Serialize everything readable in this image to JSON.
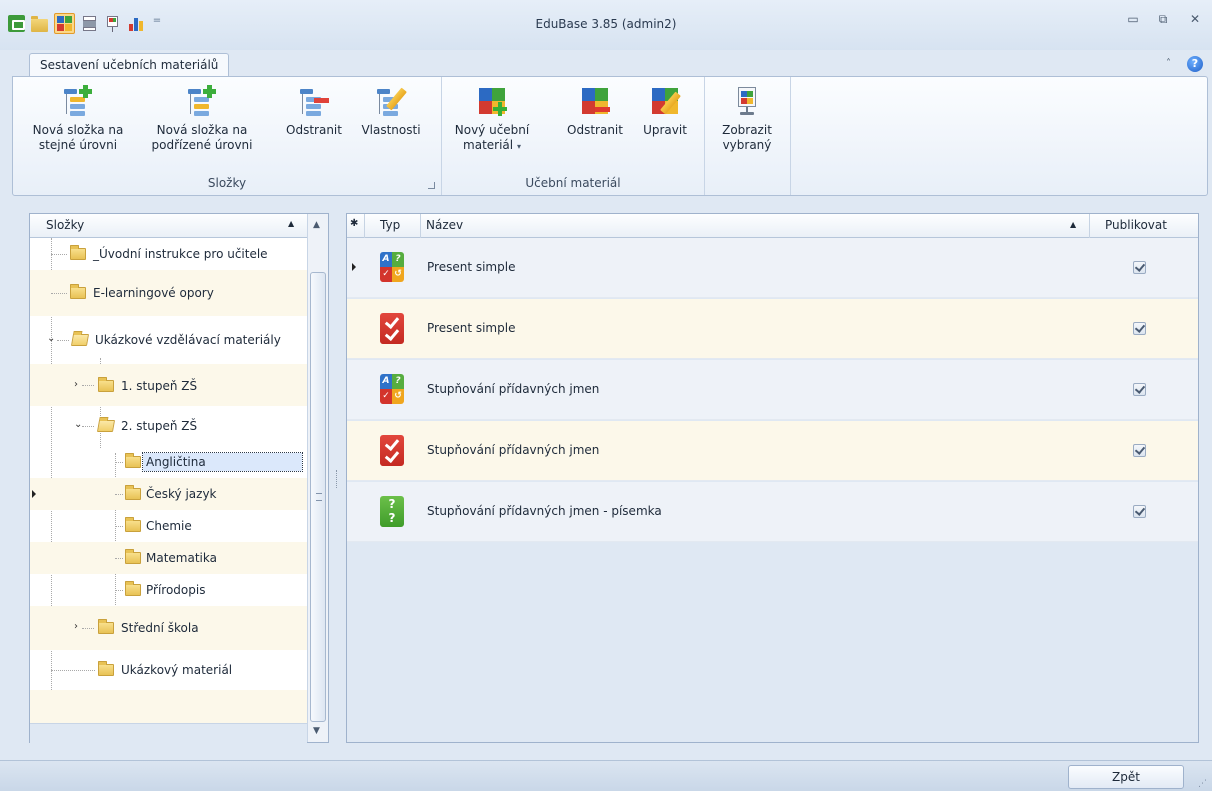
{
  "window": {
    "title": "EduBase 3.85 (admin2)",
    "minimize": "▭",
    "maximize": "⧉",
    "close": "✕"
  },
  "ribbon": {
    "tab": "Sestavení učebních materiálů",
    "collapse": "˄",
    "help": "?",
    "groups": {
      "slozky": {
        "label": "Složky",
        "buttons": [
          {
            "line1": "Nová složka na",
            "line2": "stejné úrovni"
          },
          {
            "line1": "Nová složka na",
            "line2": "podřízené úrovni"
          },
          {
            "line1": "Odstranit",
            "line2": ""
          },
          {
            "line1": "Vlastnosti",
            "line2": ""
          }
        ]
      },
      "material": {
        "label": "Učební materiál",
        "buttons": [
          {
            "line1": "Nový učební",
            "line2": "materiál",
            "caret": "▾"
          },
          {
            "line1": "Odstranit",
            "line2": ""
          },
          {
            "line1": "Upravit",
            "line2": ""
          }
        ]
      },
      "zobrazit": {
        "buttons": [
          {
            "line1": "Zobrazit",
            "line2": "vybraný"
          }
        ]
      }
    }
  },
  "tree": {
    "header": "Složky",
    "sort_glyph": "▲",
    "items": [
      {
        "label": "_Úvodní instrukce pro učitele"
      },
      {
        "label": "E-learningové opory"
      },
      {
        "label": "Ukázkové vzdělávací materiály",
        "expander": "⌄"
      },
      {
        "label": "1. stupeň ZŠ",
        "expander": "›"
      },
      {
        "label": "2. stupeň ZŠ",
        "expander": "⌄"
      },
      {
        "label": "Angličtina"
      },
      {
        "label": "Český jazyk"
      },
      {
        "label": "Chemie"
      },
      {
        "label": "Matematika"
      },
      {
        "label": "Přírodopis"
      },
      {
        "label": "Střední škola",
        "expander": "›"
      },
      {
        "label": "Ukázkový materiál"
      }
    ]
  },
  "materials": {
    "columns": {
      "star": "✱",
      "type": "Typ",
      "name": "Název",
      "sort_glyph": "▲",
      "publish": "Publikovat"
    },
    "rows": [
      {
        "name": "Present simple",
        "type_icon": "mixed-test-icon",
        "publish": true
      },
      {
        "name": "Present simple",
        "type_icon": "check-test-icon",
        "publish": true
      },
      {
        "name": "Stupňování přídavných jmen",
        "type_icon": "mixed-test-icon",
        "publish": true
      },
      {
        "name": "Stupňování přídavných jmen",
        "type_icon": "check-test-icon",
        "publish": true
      },
      {
        "name": "Stupňování přídavných jmen - písemka",
        "type_icon": "question-test-icon",
        "publish": true
      }
    ]
  },
  "status": {
    "back": "Zpět"
  },
  "colors": {
    "window_bg": "#dfe8f3",
    "row_alt": "#fcf8ea",
    "selection": "#dbe8fb"
  }
}
